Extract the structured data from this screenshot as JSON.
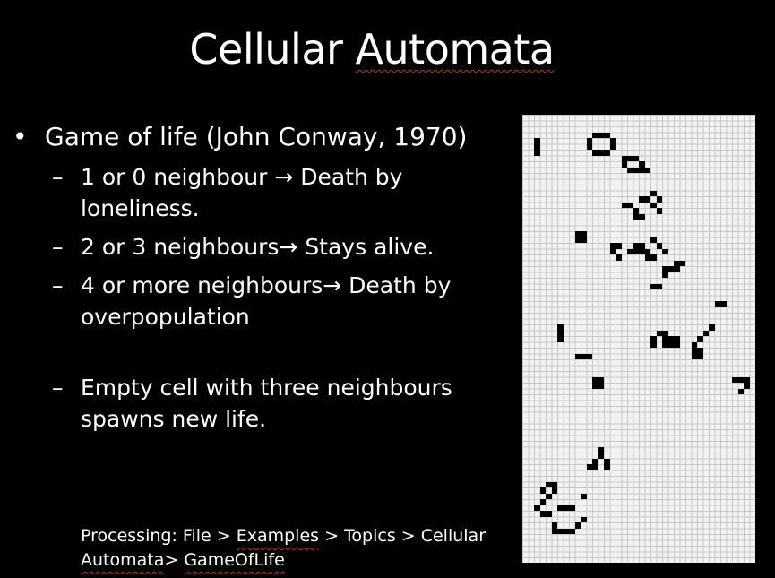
{
  "slide": {
    "title_word1": "Cellular",
    "title_word2": "Automata"
  },
  "bullets": {
    "main": "Game of life (John Conway, 1970)",
    "items": [
      "1 or 0 neighbour → Death by loneliness.",
      "2 or 3 neighbours→ Stays alive.",
      "4 or more neighbours→ Death by overpopulation",
      "Empty cell with three neighbours spawns new life."
    ]
  },
  "footer": {
    "prefix": "Processing: File > ",
    "examples": "Examples",
    "topics": " > Topics > Cellular ",
    "automata": "Automata",
    "sep": "> ",
    "gameoflife": "GameOfLife"
  },
  "grid": {
    "cols": 40,
    "rows": 77,
    "live_cells": [
      [
        2,
        4
      ],
      [
        2,
        5
      ],
      [
        2,
        6
      ],
      [
        12,
        3
      ],
      [
        13,
        3
      ],
      [
        14,
        3
      ],
      [
        11,
        4
      ],
      [
        15,
        4
      ],
      [
        11,
        5
      ],
      [
        15,
        5
      ],
      [
        12,
        6
      ],
      [
        13,
        6
      ],
      [
        14,
        6
      ],
      [
        17,
        7
      ],
      [
        18,
        7
      ],
      [
        19,
        7
      ],
      [
        17,
        8
      ],
      [
        20,
        8
      ],
      [
        18,
        9
      ],
      [
        19,
        9
      ],
      [
        21,
        9
      ],
      [
        20,
        9
      ],
      [
        22,
        13
      ],
      [
        20,
        14
      ],
      [
        21,
        14
      ],
      [
        23,
        14
      ],
      [
        17,
        15
      ],
      [
        18,
        15
      ],
      [
        22,
        15
      ],
      [
        19,
        16
      ],
      [
        23,
        16
      ],
      [
        19,
        17
      ],
      [
        20,
        17
      ],
      [
        9,
        20
      ],
      [
        10,
        20
      ],
      [
        9,
        21
      ],
      [
        10,
        21
      ],
      [
        22,
        21
      ],
      [
        15,
        22
      ],
      [
        16,
        22
      ],
      [
        19,
        22
      ],
      [
        20,
        22
      ],
      [
        23,
        22
      ],
      [
        15,
        23
      ],
      [
        18,
        23
      ],
      [
        19,
        23
      ],
      [
        20,
        23
      ],
      [
        21,
        23
      ],
      [
        24,
        23
      ],
      [
        16,
        24
      ],
      [
        21,
        24
      ],
      [
        22,
        24
      ],
      [
        26,
        25
      ],
      [
        27,
        25
      ],
      [
        24,
        26
      ],
      [
        25,
        26
      ],
      [
        26,
        26
      ],
      [
        24,
        27
      ],
      [
        22,
        29
      ],
      [
        23,
        29
      ],
      [
        33,
        32
      ],
      [
        34,
        32
      ],
      [
        32,
        36
      ],
      [
        6,
        36
      ],
      [
        31,
        37
      ],
      [
        6,
        37
      ],
      [
        23,
        37
      ],
      [
        24,
        37
      ],
      [
        6,
        38
      ],
      [
        30,
        38
      ],
      [
        22,
        38
      ],
      [
        24,
        38
      ],
      [
        25,
        38
      ],
      [
        26,
        38
      ],
      [
        22,
        39
      ],
      [
        24,
        39
      ],
      [
        25,
        39
      ],
      [
        26,
        39
      ],
      [
        29,
        39
      ],
      [
        29,
        40
      ],
      [
        30,
        40
      ],
      [
        9,
        41
      ],
      [
        10,
        41
      ],
      [
        11,
        41
      ],
      [
        29,
        41
      ],
      [
        30,
        41
      ],
      [
        12,
        45
      ],
      [
        13,
        45
      ],
      [
        12,
        46
      ],
      [
        13,
        46
      ],
      [
        36,
        45
      ],
      [
        37,
        45
      ],
      [
        38,
        45
      ],
      [
        38,
        46
      ],
      [
        37,
        47
      ],
      [
        13,
        57
      ],
      [
        13,
        58
      ],
      [
        12,
        59
      ],
      [
        14,
        59
      ],
      [
        11,
        60
      ],
      [
        12,
        60
      ],
      [
        14,
        60
      ],
      [
        4,
        63
      ],
      [
        5,
        63
      ],
      [
        3,
        64
      ],
      [
        5,
        64
      ],
      [
        10,
        65
      ],
      [
        2,
        67
      ],
      [
        3,
        66
      ],
      [
        4,
        65
      ],
      [
        6,
        67
      ],
      [
        7,
        67
      ],
      [
        8,
        67
      ],
      [
        3,
        68
      ],
      [
        4,
        68
      ],
      [
        10,
        69
      ],
      [
        5,
        70
      ],
      [
        9,
        70
      ],
      [
        5,
        71
      ],
      [
        6,
        71
      ],
      [
        7,
        71
      ],
      [
        8,
        71
      ]
    ]
  }
}
